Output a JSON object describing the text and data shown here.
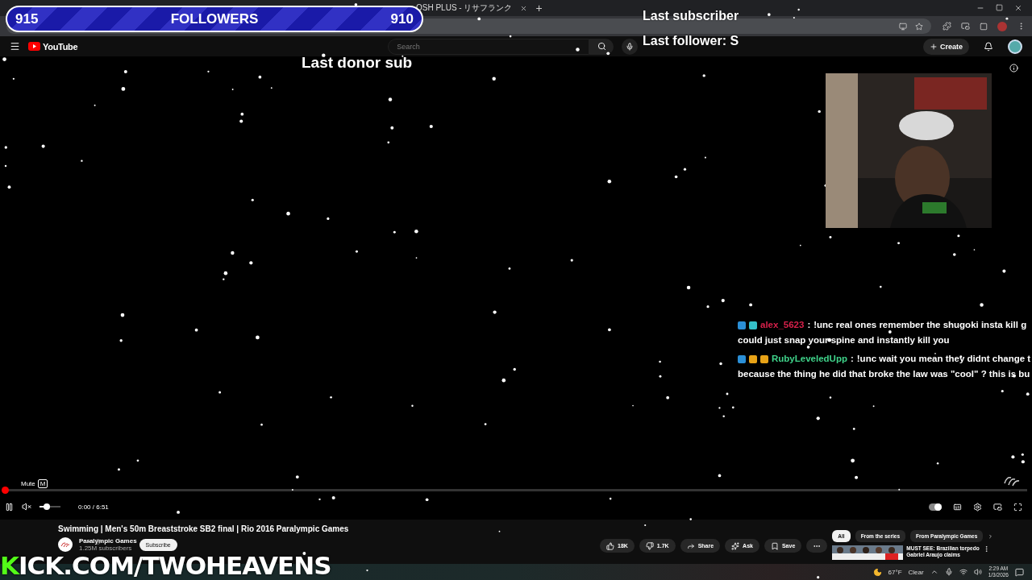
{
  "follower_goal": {
    "current": "915",
    "label": "FOLLOWERS",
    "target": "910"
  },
  "browser": {
    "tab_title": "OSH PLUS - リサフランク",
    "new_tab": "+"
  },
  "youtube": {
    "logo": "YouTube",
    "search_placeholder": "Search",
    "create": "Create"
  },
  "overlays": {
    "last_subscriber": "Last subscriber",
    "last_follower": "Last follower: S",
    "last_donor": "Last donor sub",
    "kick": "KICK.COM/TWOHEAVENS"
  },
  "chat": [
    {
      "user": "alex_5623",
      "separator": ":",
      "color": "#d6204a",
      "badges": [
        {
          "color": "#2b8fd6"
        },
        {
          "color": "#35c1c9"
        }
      ],
      "lines": [
        "!unc real ones remember the shugoki insta kill g",
        "could just snap your spine and instantly kill you"
      ]
    },
    {
      "user": "RubyLeveledUpp",
      "separator": ":",
      "color": "#3fd38a",
      "badges": [
        {
          "color": "#2b8fd6"
        },
        {
          "color": "#e8a317"
        },
        {
          "color": "#e8a317"
        }
      ],
      "lines": [
        "!unc wait you mean they didnt change t",
        "because the thing he did that broke the law was \"cool\" ? this is bu"
      ]
    }
  ],
  "player": {
    "mute_tooltip": "Mute",
    "mute_key": "M",
    "time": "0:00 / 6:51",
    "paused": false,
    "progress": {
      "level": 0
    },
    "volume": {
      "level": 0.35
    },
    "autoplay": {
      "on": true
    }
  },
  "video": {
    "title": "Swimming | Men's 50m Breaststroke SB2 final | Rio 2016 Paralympic Games",
    "channel": "Paralympic Games",
    "subscribers": "1.25M subscribers",
    "subscribe": "Subscribe",
    "likes": "18K",
    "dislikes": "1.7K",
    "share": "Share",
    "ask": "Ask",
    "save": "Save"
  },
  "chips": [
    {
      "label": "All",
      "selected": true
    },
    {
      "label": "From the series",
      "selected": false
    },
    {
      "label": "From Paralympic Games",
      "selected": false
    }
  ],
  "recommended": {
    "title": "MUST SEE: Brazilian torpedo",
    "subtitle": "Gabriel Araujo claims"
  },
  "taskbar": {
    "temperature": "67°F",
    "condition": "Clear",
    "time": "2:29 AM",
    "date": "1/3/2026"
  }
}
